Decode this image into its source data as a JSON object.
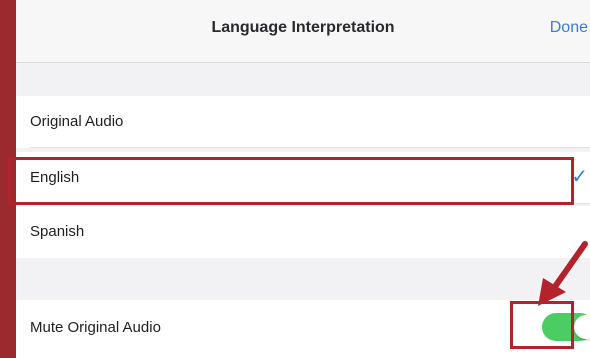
{
  "header": {
    "title": "Language Interpretation",
    "done_label": "Done"
  },
  "languages": [
    {
      "label": "Original Audio",
      "selected": false
    },
    {
      "label": "English",
      "selected": true
    },
    {
      "label": "Spanish",
      "selected": false
    }
  ],
  "mute": {
    "label": "Mute Original Audio",
    "enabled": true
  },
  "icons": {
    "checkmark": "checkmark-icon",
    "arrow": "red-arrow-icon"
  },
  "colors": {
    "accent": "#3c7bd2",
    "toggle_on": "#4ccd63",
    "highlight": "#b3232b",
    "frame": "#9a2a2e"
  }
}
